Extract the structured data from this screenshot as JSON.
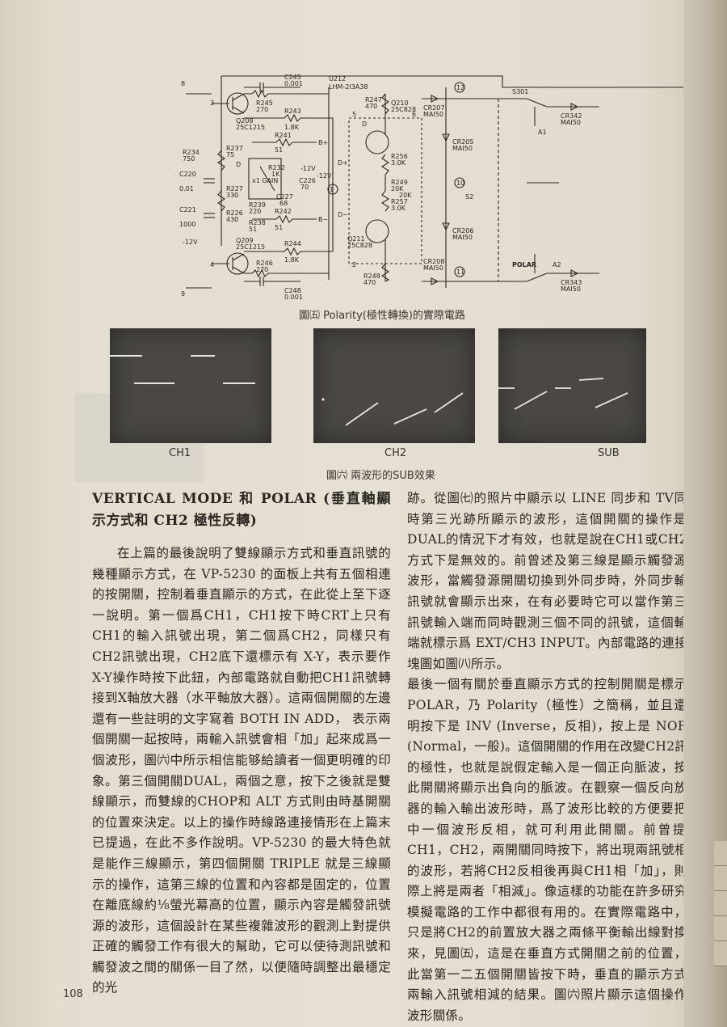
{
  "figure_circuit": {
    "caption": "圖㈤ Polarity(極性轉換)的實際電路",
    "labels": {
      "u212": "U212",
      "u212_part": "LHM-2I3A38",
      "c245": "C245",
      "c245_v": "0.001",
      "r245": "R245",
      "r245_v": "270",
      "q208": "Q208",
      "q208_p": "25C1215",
      "r243": "R243",
      "r243_v": "1.8K",
      "r241": "R241",
      "r241_v": "51",
      "r234": "R234",
      "r234_v": "750",
      "r237": "R237",
      "r237_v": "75",
      "c220": "C220",
      "c220_v": "0.01",
      "r227": "R227",
      "r227_v": "330",
      "r239": "R239",
      "r239_v": "220",
      "c227": "C227",
      "c227_v": "68",
      "r232": "R232",
      "r232_v": "1K",
      "x1gain": "x1 GAIN",
      "c226": "C226",
      "c226_v": "70",
      "c221": "C221",
      "c221_v": "1000",
      "r226": "R226",
      "r226_v": "430",
      "r238": "R238",
      "r238_v": "51",
      "r242": "R242",
      "r242_v": "51",
      "m12v_a": "-12V",
      "m12v_b": "-12V",
      "m12v_c": "-12V",
      "q209": "Q209",
      "q209_p": "25C1215",
      "r246": "R246",
      "r246_v": "270",
      "r244": "R244",
      "r244_v": "1.8K",
      "c248": "C248",
      "c248_v": "0.001",
      "r247": "R247",
      "r247_v": "470",
      "q210": "Q210",
      "q210_p": "25C828",
      "cr207": "CR207",
      "cr207_p": "MAI50",
      "cr205": "CR205",
      "cr205_p": "MAI50",
      "r256": "R256",
      "r256_v": "3.0K",
      "r249": "R249",
      "r249_v": "20K",
      "r257": "R257",
      "r257_v": "3.0K",
      "r249_b": "20K",
      "cr206": "CR206",
      "cr206_p": "MAI50",
      "cr208": "CR208",
      "cr208_p": "MAI50",
      "q211": "Q211",
      "q211_p": "25C828",
      "r248": "R248",
      "r248_v": "470",
      "s301": "S301",
      "cr342": "CR342",
      "cr342_p": "MAI50",
      "cr343": "CR343",
      "cr343_p": "MAI50",
      "a1": "A1",
      "a2": "A2",
      "s2": "S2",
      "polar": "POLAR",
      "bplus": "B+",
      "bminus": "B−",
      "dplus": "D+",
      "dminus": "D−",
      "n1": "1",
      "n2": "2",
      "n3": "3",
      "n4": "4",
      "n5": "5",
      "n6": "6",
      "n8": "8",
      "n9": "9",
      "n10": "10",
      "n11": "11",
      "n12": "12",
      "d": "D",
      "d2": "D"
    }
  },
  "figure_scope": {
    "caption": "圖㈥ 兩波形的SUB效果",
    "panels": [
      "CH1",
      "CH2",
      "SUB"
    ]
  },
  "article": {
    "heading": "VERTICAL MODE 和 POLAR (垂直軸顯示方式和 CH2 極性反轉)",
    "left_paragraph": "在上篇的最後說明了雙線顯示方式和垂直訊號的幾種顯示方式，在 VP-5230 的面板上共有五個相連的按開關，控制着垂直顯示的方式，在此從上至下逐一說明。第一個爲CH1，CH1按下時CRT上只有CH1的輸入訊號出現，第二個爲CH2，同樣只有CH2訊號出現，CH2底下還標示有 X-Y，表示要作X-Y操作時按下此鈕，內部電路就自動把CH1訊號轉接到X軸放大器（水平軸放大器）。這兩個開關的左邊還有一些註明的文字寫着 BOTH IN ADD， 表示兩個開關一起按時，兩輸入訊號會相「加」起來成爲一個波形，圖㈥中所示相信能够給讀者一個更明確的印象。第三個開關DUAL，兩個之意，按下之後就是雙線顯示，而雙線的CHOP和 ALT 方式則由時基開關的位置來決定。以上的操作時線路連接情形在上篇末已提過，在此不多作說明。VP-5230 的最大特色就是能作三線顯示，第四個開關 TRIPLE 就是三線顯示的操作，這第三線的位置和內容都是固定的，位置在離底線約⅛螢光幕高的位置，顯示內容是觸發訊號源的波形，這個設計在某些複雜波形的觀測上對提供正確的觸發工作有很大的幫助，它可以使待測訊號和觸發波之間的關係一目了然，以便隨時調整出最穩定的光",
    "right_paragraph_1": "跡。從圖㈦的照片中顯示以 LINE 同步和 TV同步時第三光跡所顯示的波形，這個開關的操作是在DUAL的情況下才有效，也就是說在CH1或CH2的方式下是無效的。前曾述及第三線是顯示觸發源的波形，當觸發源開關切換到外同步時，外同步輸入訊號就會顯示出來，在有必要時它可以當作第三個訊號輸入端而同時觀測三個不同的訊號，這個輸入端就標示爲 EXT/CH3 INPUT。內部電路的連接方塊圖如圖㈧所示。",
    "right_paragraph_2": "最後一個有關於垂直顯示方式的控制開關是標示着POLAR，乃 Polarity（極性）之簡稱，並且還註明按下是 INV (Inverse，反相)，按上是 NORM (Normal，一般)。這個開關的作用在改變CH2訊號的極性，也就是說假定輸入是一個正向脈波，按下此開關將顯示出負向的脈波。在觀察一個反向放大器的輸入輸出波形時，爲了波形比較的方便要把其中一個波形反相，就可利用此開關。前曾提及 CH1，CH2，兩開關同時按下，將出現兩訊號相加的波形，若將CH2反相後再與CH1相「加」，則實際上將是兩者「相減」。像這樣的功能在許多研究或模擬電路的工作中都很有用的。在實際電路中，它只是將CH2的前置放大器之兩條平衡輸出線對換過來，見圖㈤，這是在垂直方式開關之前的位置，因此當第一二五個開關皆按下時，垂直的顯示方式是兩輸入訊號相減的結果。圖㈥照片顯示這個操作的波形關係。"
  },
  "footer": {
    "page_number": "108"
  }
}
